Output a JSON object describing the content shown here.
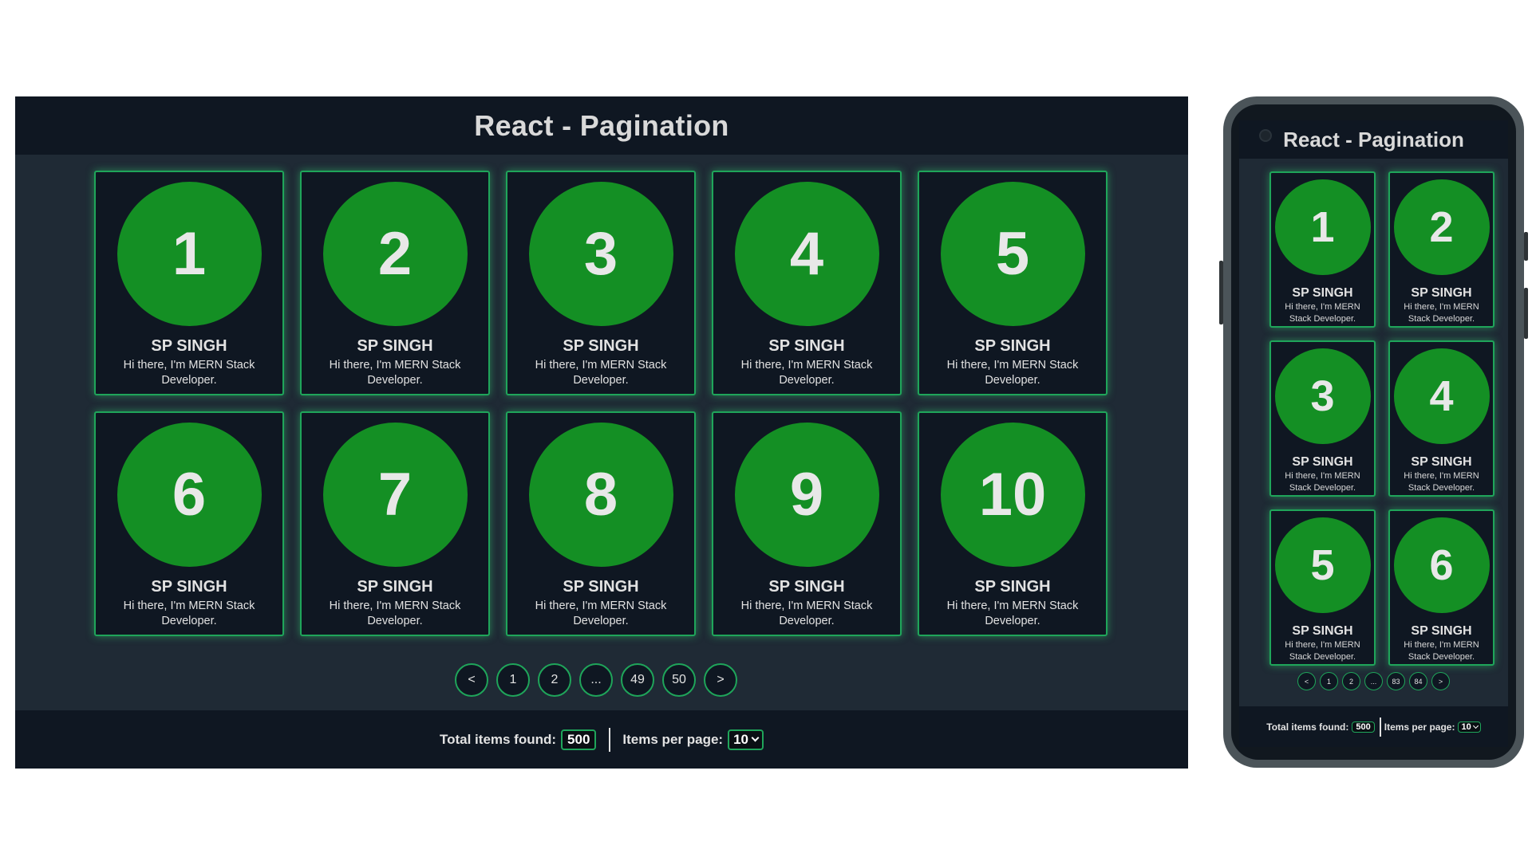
{
  "desktop": {
    "title": "React - Pagination",
    "cards": [
      {
        "number": "1",
        "name": "SP SINGH",
        "description": "Hi there, I'm MERN Stack Developer."
      },
      {
        "number": "2",
        "name": "SP SINGH",
        "description": "Hi there, I'm MERN Stack Developer."
      },
      {
        "number": "3",
        "name": "SP SINGH",
        "description": "Hi there, I'm MERN Stack Developer."
      },
      {
        "number": "4",
        "name": "SP SINGH",
        "description": "Hi there, I'm MERN Stack Developer."
      },
      {
        "number": "5",
        "name": "SP SINGH",
        "description": "Hi there, I'm MERN Stack Developer."
      },
      {
        "number": "6",
        "name": "SP SINGH",
        "description": "Hi there, I'm MERN Stack Developer."
      },
      {
        "number": "7",
        "name": "SP SINGH",
        "description": "Hi there, I'm MERN Stack Developer."
      },
      {
        "number": "8",
        "name": "SP SINGH",
        "description": "Hi there, I'm MERN Stack Developer."
      },
      {
        "number": "9",
        "name": "SP SINGH",
        "description": "Hi there, I'm MERN Stack Developer."
      },
      {
        "number": "10",
        "name": "SP SINGH",
        "description": "Hi there, I'm MERN Stack Developer."
      }
    ],
    "pagination": [
      "<",
      "1",
      "2",
      "...",
      "49",
      "50",
      ">"
    ],
    "footer": {
      "total_label": "Total items found:",
      "total_value": "500",
      "per_page_label": "Items per page:",
      "per_page_value": "10"
    }
  },
  "mobile": {
    "title": "React - Pagination",
    "cards": [
      {
        "number": "1",
        "name": "SP SINGH",
        "description": "Hi there, I'm MERN Stack Developer."
      },
      {
        "number": "2",
        "name": "SP SINGH",
        "description": "Hi there, I'm MERN Stack Developer."
      },
      {
        "number": "3",
        "name": "SP SINGH",
        "description": "Hi there, I'm MERN Stack Developer."
      },
      {
        "number": "4",
        "name": "SP SINGH",
        "description": "Hi there, I'm MERN Stack Developer."
      },
      {
        "number": "5",
        "name": "SP SINGH",
        "description": "Hi there, I'm MERN Stack Developer."
      },
      {
        "number": "6",
        "name": "SP SINGH",
        "description": "Hi there, I'm MERN Stack Developer."
      }
    ],
    "pagination": [
      "<",
      "1",
      "2",
      "...",
      "83",
      "84",
      ">"
    ],
    "footer": {
      "total_label": "Total items found:",
      "total_value": "500",
      "per_page_label": "Items per page:",
      "per_page_value": "10"
    }
  },
  "colors": {
    "accent_green": "#1fa55a",
    "circle_green": "#148f24",
    "header_bg": "#0f1722",
    "content_bg": "#1f2a35"
  },
  "icons": {
    "select_chevron": "chevron-down-icon",
    "camera": "camera-icon"
  }
}
